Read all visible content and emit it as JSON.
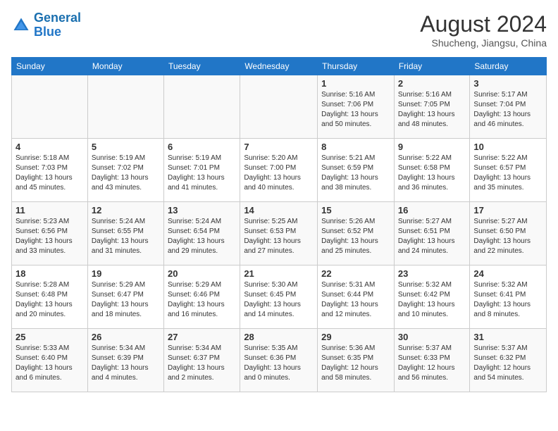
{
  "logo": {
    "line1": "General",
    "line2": "Blue"
  },
  "title": {
    "month_year": "August 2024",
    "location": "Shucheng, Jiangsu, China"
  },
  "weekdays": [
    "Sunday",
    "Monday",
    "Tuesday",
    "Wednesday",
    "Thursday",
    "Friday",
    "Saturday"
  ],
  "weeks": [
    [
      {
        "day": "",
        "info": ""
      },
      {
        "day": "",
        "info": ""
      },
      {
        "day": "",
        "info": ""
      },
      {
        "day": "",
        "info": ""
      },
      {
        "day": "1",
        "sunrise": "Sunrise: 5:16 AM",
        "sunset": "Sunset: 7:06 PM",
        "daylight": "Daylight: 13 hours and 50 minutes."
      },
      {
        "day": "2",
        "sunrise": "Sunrise: 5:16 AM",
        "sunset": "Sunset: 7:05 PM",
        "daylight": "Daylight: 13 hours and 48 minutes."
      },
      {
        "day": "3",
        "sunrise": "Sunrise: 5:17 AM",
        "sunset": "Sunset: 7:04 PM",
        "daylight": "Daylight: 13 hours and 46 minutes."
      }
    ],
    [
      {
        "day": "4",
        "sunrise": "Sunrise: 5:18 AM",
        "sunset": "Sunset: 7:03 PM",
        "daylight": "Daylight: 13 hours and 45 minutes."
      },
      {
        "day": "5",
        "sunrise": "Sunrise: 5:19 AM",
        "sunset": "Sunset: 7:02 PM",
        "daylight": "Daylight: 13 hours and 43 minutes."
      },
      {
        "day": "6",
        "sunrise": "Sunrise: 5:19 AM",
        "sunset": "Sunset: 7:01 PM",
        "daylight": "Daylight: 13 hours and 41 minutes."
      },
      {
        "day": "7",
        "sunrise": "Sunrise: 5:20 AM",
        "sunset": "Sunset: 7:00 PM",
        "daylight": "Daylight: 13 hours and 40 minutes."
      },
      {
        "day": "8",
        "sunrise": "Sunrise: 5:21 AM",
        "sunset": "Sunset: 6:59 PM",
        "daylight": "Daylight: 13 hours and 38 minutes."
      },
      {
        "day": "9",
        "sunrise": "Sunrise: 5:22 AM",
        "sunset": "Sunset: 6:58 PM",
        "daylight": "Daylight: 13 hours and 36 minutes."
      },
      {
        "day": "10",
        "sunrise": "Sunrise: 5:22 AM",
        "sunset": "Sunset: 6:57 PM",
        "daylight": "Daylight: 13 hours and 35 minutes."
      }
    ],
    [
      {
        "day": "11",
        "sunrise": "Sunrise: 5:23 AM",
        "sunset": "Sunset: 6:56 PM",
        "daylight": "Daylight: 13 hours and 33 minutes."
      },
      {
        "day": "12",
        "sunrise": "Sunrise: 5:24 AM",
        "sunset": "Sunset: 6:55 PM",
        "daylight": "Daylight: 13 hours and 31 minutes."
      },
      {
        "day": "13",
        "sunrise": "Sunrise: 5:24 AM",
        "sunset": "Sunset: 6:54 PM",
        "daylight": "Daylight: 13 hours and 29 minutes."
      },
      {
        "day": "14",
        "sunrise": "Sunrise: 5:25 AM",
        "sunset": "Sunset: 6:53 PM",
        "daylight": "Daylight: 13 hours and 27 minutes."
      },
      {
        "day": "15",
        "sunrise": "Sunrise: 5:26 AM",
        "sunset": "Sunset: 6:52 PM",
        "daylight": "Daylight: 13 hours and 25 minutes."
      },
      {
        "day": "16",
        "sunrise": "Sunrise: 5:27 AM",
        "sunset": "Sunset: 6:51 PM",
        "daylight": "Daylight: 13 hours and 24 minutes."
      },
      {
        "day": "17",
        "sunrise": "Sunrise: 5:27 AM",
        "sunset": "Sunset: 6:50 PM",
        "daylight": "Daylight: 13 hours and 22 minutes."
      }
    ],
    [
      {
        "day": "18",
        "sunrise": "Sunrise: 5:28 AM",
        "sunset": "Sunset: 6:48 PM",
        "daylight": "Daylight: 13 hours and 20 minutes."
      },
      {
        "day": "19",
        "sunrise": "Sunrise: 5:29 AM",
        "sunset": "Sunset: 6:47 PM",
        "daylight": "Daylight: 13 hours and 18 minutes."
      },
      {
        "day": "20",
        "sunrise": "Sunrise: 5:29 AM",
        "sunset": "Sunset: 6:46 PM",
        "daylight": "Daylight: 13 hours and 16 minutes."
      },
      {
        "day": "21",
        "sunrise": "Sunrise: 5:30 AM",
        "sunset": "Sunset: 6:45 PM",
        "daylight": "Daylight: 13 hours and 14 minutes."
      },
      {
        "day": "22",
        "sunrise": "Sunrise: 5:31 AM",
        "sunset": "Sunset: 6:44 PM",
        "daylight": "Daylight: 13 hours and 12 minutes."
      },
      {
        "day": "23",
        "sunrise": "Sunrise: 5:32 AM",
        "sunset": "Sunset: 6:42 PM",
        "daylight": "Daylight: 13 hours and 10 minutes."
      },
      {
        "day": "24",
        "sunrise": "Sunrise: 5:32 AM",
        "sunset": "Sunset: 6:41 PM",
        "daylight": "Daylight: 13 hours and 8 minutes."
      }
    ],
    [
      {
        "day": "25",
        "sunrise": "Sunrise: 5:33 AM",
        "sunset": "Sunset: 6:40 PM",
        "daylight": "Daylight: 13 hours and 6 minutes."
      },
      {
        "day": "26",
        "sunrise": "Sunrise: 5:34 AM",
        "sunset": "Sunset: 6:39 PM",
        "daylight": "Daylight: 13 hours and 4 minutes."
      },
      {
        "day": "27",
        "sunrise": "Sunrise: 5:34 AM",
        "sunset": "Sunset: 6:37 PM",
        "daylight": "Daylight: 13 hours and 2 minutes."
      },
      {
        "day": "28",
        "sunrise": "Sunrise: 5:35 AM",
        "sunset": "Sunset: 6:36 PM",
        "daylight": "Daylight: 13 hours and 0 minutes."
      },
      {
        "day": "29",
        "sunrise": "Sunrise: 5:36 AM",
        "sunset": "Sunset: 6:35 PM",
        "daylight": "Daylight: 12 hours and 58 minutes."
      },
      {
        "day": "30",
        "sunrise": "Sunrise: 5:37 AM",
        "sunset": "Sunset: 6:33 PM",
        "daylight": "Daylight: 12 hours and 56 minutes."
      },
      {
        "day": "31",
        "sunrise": "Sunrise: 5:37 AM",
        "sunset": "Sunset: 6:32 PM",
        "daylight": "Daylight: 12 hours and 54 minutes."
      }
    ]
  ]
}
